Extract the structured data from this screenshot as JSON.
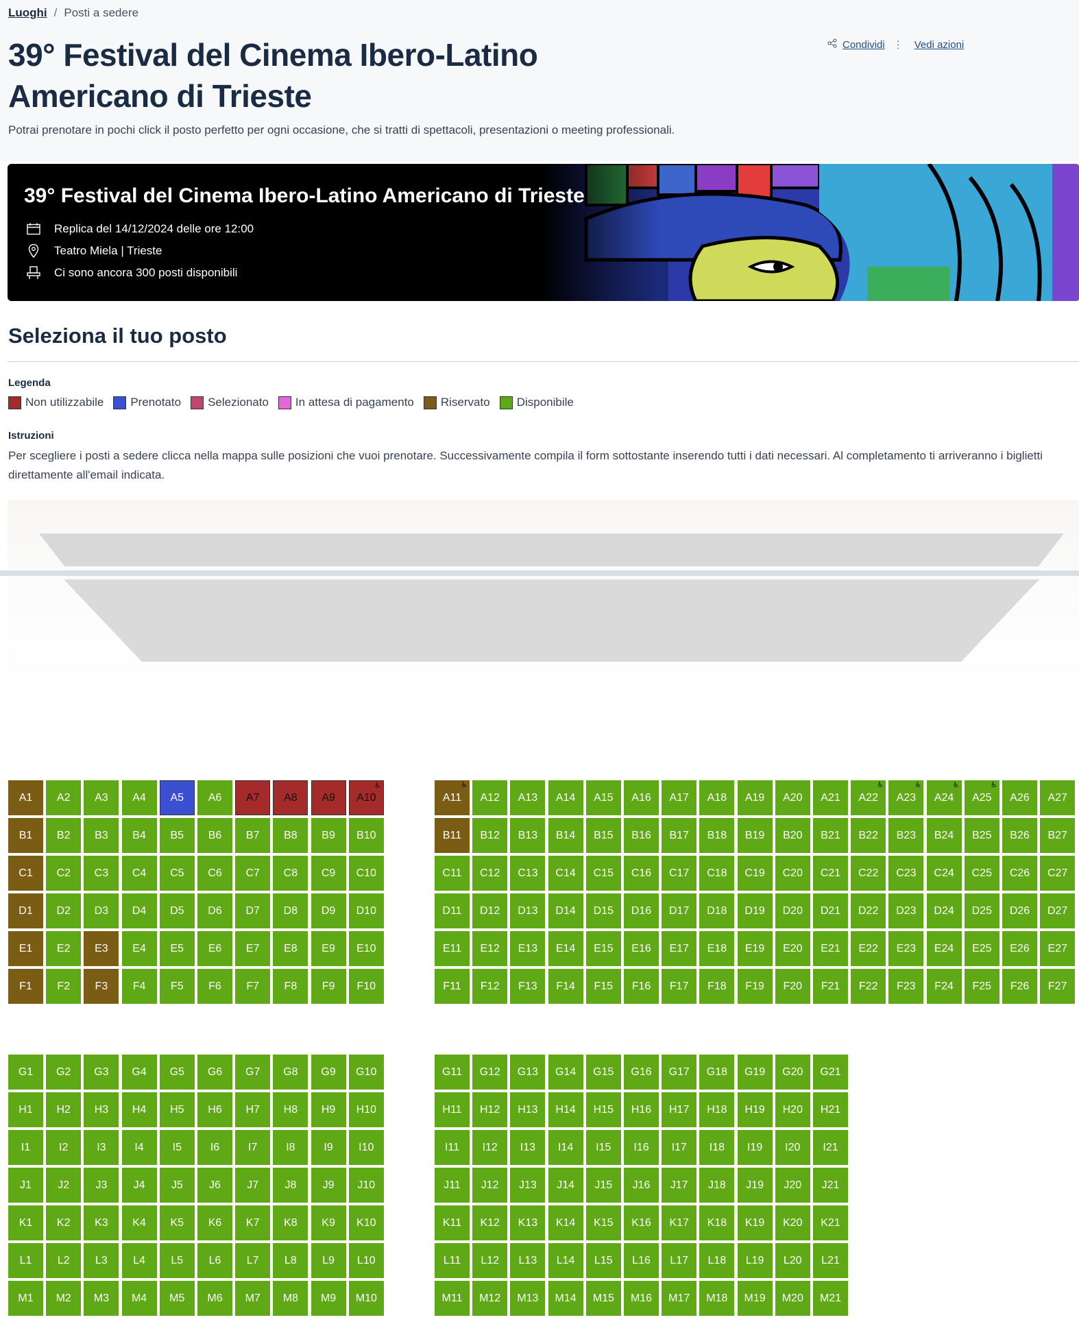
{
  "breadcrumb": {
    "home": "Luoghi",
    "current": "Posti a sedere"
  },
  "page": {
    "title": "39° Festival del Cinema Ibero-Latino Americano di Trieste",
    "subtitle": "Potrai prenotare in pochi click il posto perfetto per ogni occasione, che si tratti di spettacoli, presentazioni o meeting professionali."
  },
  "actions": {
    "share": "Condividi",
    "more": "Vedi azioni"
  },
  "banner": {
    "title": "39° Festival del Cinema Ibero-Latino Americano di Trieste",
    "date": "Replica del 14/12/2024 delle ore 12:00",
    "place": "Teatro Miela | Trieste",
    "seats": "Ci sono ancora 300 posti disponibili"
  },
  "section": {
    "title": "Seleziona il tuo posto"
  },
  "legend": {
    "label": "Legenda",
    "items": [
      {
        "label": "Non utilizzabile",
        "color": "#a52a2a"
      },
      {
        "label": "Prenotato",
        "color": "#3b4fd1"
      },
      {
        "label": "Selezionato",
        "color": "#c2456d"
      },
      {
        "label": "In attesa di pagamento",
        "color": "#e466d8"
      },
      {
        "label": "Riservato",
        "color": "#7a5c14"
      },
      {
        "label": "Disponibile",
        "color": "#5ea915"
      }
    ]
  },
  "instructions": {
    "label": "Istruzioni",
    "text": "Per scegliere i posti a sedere clicca nella mappa sulle posizioni che vuoi prenotare. Successivamente compila il form sottostante inserendo tutti i dati necessari. Al completamento ti arriveranno i biglietti direttamente all'email indicata."
  },
  "icons": {
    "share": "share-icon",
    "more": "vertical-dots-icon",
    "calendar": "calendar-icon",
    "place": "map-pin-icon",
    "seat": "seat-icon",
    "wheelchair": "wheelchair-icon"
  },
  "seatmap": {
    "status_colors": {
      "available": "#5ea915",
      "reserved": "#7a5c14",
      "booked": "#3b4fd1",
      "unusable": "#a52a2a"
    },
    "sections": [
      {
        "rows": [
          "A",
          "B",
          "C",
          "D",
          "E",
          "F"
        ],
        "from": 1,
        "to": 10
      },
      {
        "rows": [
          "A",
          "B",
          "C",
          "D",
          "E",
          "F"
        ],
        "from": 11,
        "to": 27
      },
      {
        "rows": [
          "G",
          "H",
          "I",
          "J",
          "K",
          "L",
          "M"
        ],
        "from": 1,
        "to": 10
      },
      {
        "rows": [
          "G",
          "H",
          "I",
          "J",
          "K",
          "L",
          "M"
        ],
        "from": 11,
        "to": 21
      }
    ],
    "special": {
      "A1": "reserved",
      "B1": "reserved",
      "C1": "reserved",
      "D1": "reserved",
      "E1": "reserved",
      "F1": "reserved",
      "E3": "reserved",
      "F3": "reserved",
      "A11": "reserved",
      "B11": "reserved",
      "A5": "booked",
      "A7": "unusable",
      "A8": "unusable",
      "A9": "unusable",
      "A10": "unusable"
    },
    "wheelchair": [
      "A10",
      "A11",
      "A22",
      "A23",
      "A24",
      "A25"
    ]
  }
}
